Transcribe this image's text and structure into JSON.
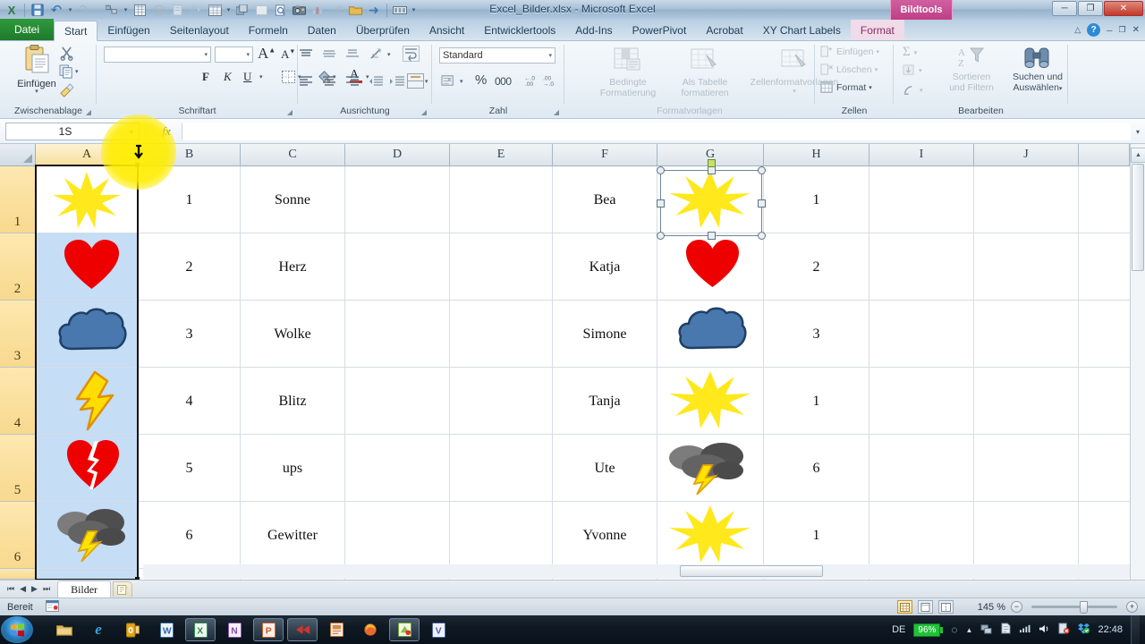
{
  "window": {
    "title": "Excel_Bilder.xlsx - Microsoft Excel",
    "minimize": "─",
    "restore": "❐",
    "close": "✕"
  },
  "quick_access": [
    {
      "name": "excel-logo-icon",
      "glyph": "X"
    },
    {
      "name": "save-icon",
      "glyph": "💾"
    },
    {
      "name": "undo-icon",
      "glyph": "↶"
    },
    {
      "name": "undo-dropdown-icon",
      "glyph": "▾"
    },
    {
      "name": "redo-icon",
      "glyph": "↷"
    },
    {
      "name": "redo-dropdown-icon",
      "glyph": "▾"
    },
    {
      "name": "shapes-icon",
      "glyph": "⌘"
    },
    {
      "name": "shapes-dropdown-icon",
      "glyph": "▾"
    },
    {
      "name": "calculate-icon",
      "glyph": "▦"
    },
    {
      "name": "spellcheck-icon",
      "glyph": "Ⓐ"
    },
    {
      "name": "format-painter-icon",
      "glyph": "▤"
    },
    {
      "name": "filter-icon",
      "glyph": "☰"
    },
    {
      "name": "table-icon",
      "glyph": "▦"
    },
    {
      "name": "table-dropdown-icon",
      "glyph": "▾"
    },
    {
      "name": "group-icon",
      "glyph": "❐"
    },
    {
      "name": "blank-icon",
      "glyph": "▭"
    },
    {
      "name": "print-preview-icon",
      "glyph": "◔"
    },
    {
      "name": "camera-icon",
      "glyph": "▣"
    },
    {
      "name": "chart-icon",
      "glyph": "▥"
    },
    {
      "name": "function-icon",
      "glyph": "ℱ"
    },
    {
      "name": "open-folder-icon",
      "glyph": "🗀"
    },
    {
      "name": "arrow-icon",
      "glyph": "➡"
    },
    {
      "name": "qat-customize-icon",
      "glyph": "▬"
    },
    {
      "name": "qat-dropdown-icon",
      "glyph": "▾"
    }
  ],
  "tabs": [
    {
      "label": "Datei",
      "state": "file"
    },
    {
      "label": "Start",
      "state": "active"
    },
    {
      "label": "Einfügen",
      "state": "normal"
    },
    {
      "label": "Seitenlayout",
      "state": "normal"
    },
    {
      "label": "Formeln",
      "state": "normal"
    },
    {
      "label": "Daten",
      "state": "normal"
    },
    {
      "label": "Überprüfen",
      "state": "normal"
    },
    {
      "label": "Ansicht",
      "state": "normal"
    },
    {
      "label": "Entwicklertools",
      "state": "normal"
    },
    {
      "label": "Add-Ins",
      "state": "normal"
    },
    {
      "label": "PowerPivot",
      "state": "normal"
    },
    {
      "label": "Acrobat",
      "state": "normal"
    },
    {
      "label": "XY Chart Labels",
      "state": "normal"
    },
    {
      "label": "Format",
      "state": "context"
    }
  ],
  "contextual_tab_group": {
    "label": "Bildtools",
    "color": "#bf3e86"
  },
  "help_icons": [
    {
      "name": "minimize-ribbon-icon",
      "glyph": "△"
    },
    {
      "name": "help-icon",
      "glyph": "?"
    },
    {
      "name": "window-minimize-icon",
      "glyph": "─"
    },
    {
      "name": "window-restore-icon",
      "glyph": "❐"
    },
    {
      "name": "window-close-icon",
      "glyph": "✕"
    }
  ],
  "ribbon": {
    "groups": [
      {
        "name": "zwischenablage",
        "label": "Zwischenablage",
        "items": [
          {
            "name": "paste-button",
            "label": "Einfügen",
            "icon": "clipboard-icon"
          },
          {
            "name": "cut-button",
            "label": "",
            "icon": "scissors-icon"
          },
          {
            "name": "copy-button",
            "label": "",
            "icon": "copy-icon"
          },
          {
            "name": "format-painter-button",
            "label": "",
            "icon": "paintbrush-icon"
          }
        ]
      },
      {
        "name": "schriftart",
        "label": "Schriftart",
        "font_name": "",
        "font_size": "",
        "items": [
          {
            "name": "grow-font-button",
            "label": "A",
            "icon": "grow-font-icon"
          },
          {
            "name": "shrink-font-button",
            "label": "A",
            "icon": "shrink-font-icon"
          },
          {
            "name": "bold-button",
            "label": "F",
            "icon": "bold-icon"
          },
          {
            "name": "italic-button",
            "label": "K",
            "icon": "italic-icon"
          },
          {
            "name": "underline-button",
            "label": "U",
            "icon": "underline-icon"
          },
          {
            "name": "borders-button",
            "label": "",
            "icon": "borders-icon"
          },
          {
            "name": "fill-color-button",
            "label": "",
            "icon": "fill-color-icon"
          },
          {
            "name": "font-color-button",
            "label": "A",
            "icon": "font-color-icon"
          }
        ]
      },
      {
        "name": "ausrichtung",
        "label": "Ausrichtung",
        "items": [
          {
            "name": "align-top-button",
            "icon": "align-top-icon"
          },
          {
            "name": "align-middle-button",
            "icon": "align-middle-icon"
          },
          {
            "name": "align-bottom-button",
            "icon": "align-bottom-icon"
          },
          {
            "name": "orientation-button",
            "icon": "orientation-icon"
          },
          {
            "name": "wrap-text-button",
            "icon": "wrap-text-icon"
          },
          {
            "name": "align-left-button",
            "icon": "align-left-icon"
          },
          {
            "name": "align-center-button",
            "icon": "align-center-icon"
          },
          {
            "name": "align-right-button",
            "icon": "align-right-icon"
          },
          {
            "name": "decrease-indent-button",
            "icon": "decrease-indent-icon"
          },
          {
            "name": "increase-indent-button",
            "icon": "increase-indent-icon"
          },
          {
            "name": "merge-cells-button",
            "icon": "merge-cells-icon"
          }
        ]
      },
      {
        "name": "zahl",
        "label": "Zahl",
        "number_format": "Standard",
        "items": [
          {
            "name": "accounting-format-button",
            "label": "",
            "icon": "currency-icon"
          },
          {
            "name": "percent-format-button",
            "label": "%",
            "icon": "percent-icon"
          },
          {
            "name": "thousands-format-button",
            "label": "000",
            "icon": "comma-icon"
          },
          {
            "name": "increase-decimal-button",
            "label": "",
            "icon": "increase-decimal-icon"
          },
          {
            "name": "decrease-decimal-button",
            "label": "",
            "icon": "decrease-decimal-icon"
          }
        ]
      },
      {
        "name": "formatvorlagen",
        "label": "Formatvorlagen",
        "items": [
          {
            "name": "conditional-formatting-button",
            "label": "Bedingte\nFormatierung",
            "line1": "Bedingte",
            "line2": "Formatierung",
            "icon": "conditional-format-icon"
          },
          {
            "name": "format-as-table-button",
            "line1": "Als Tabelle",
            "line2": "formatieren",
            "icon": "table-style-icon"
          },
          {
            "name": "cell-styles-button",
            "line1": "Zellenformatvorlagen",
            "line2": "",
            "icon": "cell-style-icon"
          }
        ]
      },
      {
        "name": "zellen",
        "label": "Zellen",
        "items": [
          {
            "name": "insert-cells-button",
            "label": "Einfügen",
            "icon": "insert-cells-icon"
          },
          {
            "name": "delete-cells-button",
            "label": "Löschen",
            "icon": "delete-cells-icon"
          },
          {
            "name": "format-cells-button",
            "label": "Format",
            "icon": "format-cells-icon"
          }
        ]
      },
      {
        "name": "bearbeiten",
        "label": "Bearbeiten",
        "items": [
          {
            "name": "autosum-button",
            "label": "Σ",
            "icon": "autosum-icon"
          },
          {
            "name": "fill-button",
            "label": "",
            "icon": "fill-down-icon"
          },
          {
            "name": "clear-button",
            "label": "",
            "icon": "eraser-icon"
          },
          {
            "name": "sort-filter-button",
            "line1": "Sortieren",
            "line2": "und Filtern",
            "icon": "sort-filter-icon"
          },
          {
            "name": "find-select-button",
            "line1": "Suchen und",
            "line2": "Auswählen",
            "icon": "binoculars-icon"
          }
        ]
      }
    ]
  },
  "formula_bar": {
    "name_box_value": "1S",
    "name_box_dropdown": "▾",
    "fx_label": "fx",
    "formula_value": "",
    "expand_icon": "▾",
    "cancel_icon": "✕",
    "accept_icon": "✓"
  },
  "grid": {
    "columns": [
      {
        "label": "A",
        "selected": true
      },
      {
        "label": "B",
        "selected": false
      },
      {
        "label": "C",
        "selected": false
      },
      {
        "label": "D",
        "selected": false
      },
      {
        "label": "E",
        "selected": false
      },
      {
        "label": "F",
        "selected": false
      },
      {
        "label": "G",
        "selected": false
      },
      {
        "label": "H",
        "selected": false
      },
      {
        "label": "I",
        "selected": false
      },
      {
        "label": "J",
        "selected": false
      }
    ],
    "rows": [
      {
        "label": "1",
        "image_a": "sun-icon",
        "b": "1",
        "c": "Sonne",
        "d": "",
        "e": "",
        "f": "Bea",
        "image_g": "sun-icon",
        "h": "1"
      },
      {
        "label": "2",
        "image_a": "heart-icon",
        "b": "2",
        "c": "Herz",
        "d": "",
        "e": "",
        "f": "Katja",
        "image_g": "heart-icon",
        "h": "2"
      },
      {
        "label": "3",
        "image_a": "cloud-icon",
        "b": "3",
        "c": "Wolke",
        "d": "",
        "e": "",
        "f": "Simone",
        "image_g": "cloud-icon",
        "h": "3"
      },
      {
        "label": "4",
        "image_a": "lightning-icon",
        "b": "4",
        "c": "Blitz",
        "d": "",
        "e": "",
        "f": "Tanja",
        "image_g": "sun-icon",
        "h": "1"
      },
      {
        "label": "5",
        "image_a": "broken-heart-icon",
        "b": "5",
        "c": "ups",
        "d": "",
        "e": "",
        "f": "Ute",
        "image_g": "thunderstorm-icon",
        "h": "6"
      },
      {
        "label": "6",
        "image_a": "thunderstorm-icon",
        "b": "6",
        "c": "Gewitter",
        "d": "",
        "e": "",
        "f": "Yvonne",
        "image_g": "sun-icon",
        "h": "1"
      }
    ],
    "column_a_fill_color": "#c5ddf5",
    "selected_cell": "A1",
    "selected_picture_cell": "G1"
  },
  "sheet_tabs": {
    "nav": [
      {
        "name": "first-sheet-button",
        "glyph": "⏮"
      },
      {
        "name": "prev-sheet-button",
        "glyph": "◀"
      },
      {
        "name": "next-sheet-button",
        "glyph": "▶"
      },
      {
        "name": "last-sheet-button",
        "glyph": "⏭"
      }
    ],
    "tabs": [
      {
        "label": "Bilder",
        "active": true
      }
    ],
    "add_sheet_glyph": "⬚"
  },
  "status_bar": {
    "mode": "Bereit",
    "macro_icon": "record-macro-icon",
    "views": [
      {
        "name": "normal-view-button",
        "glyph": "▦",
        "active": true
      },
      {
        "name": "page-layout-view-button",
        "glyph": "▤",
        "active": false
      },
      {
        "name": "page-break-view-button",
        "glyph": "▥",
        "active": false
      }
    ],
    "zoom": "145 %",
    "zoom_out_glyph": "−",
    "zoom_in_glyph": "+"
  },
  "taskbar": {
    "start_glyph": "⊞",
    "apps": [
      {
        "name": "explorer-taskbar-icon",
        "glyph": "🗀",
        "color": "#e8c46a",
        "active": false
      },
      {
        "name": "internet-explorer-taskbar-icon",
        "glyph": "e",
        "color": "#2f9fe0",
        "active": false
      },
      {
        "name": "outlook-taskbar-icon",
        "glyph": "O",
        "color": "#e8a317",
        "active": false
      },
      {
        "name": "word-taskbar-icon",
        "glyph": "W",
        "color": "#3b7ed0",
        "active": false
      },
      {
        "name": "excel-taskbar-icon",
        "glyph": "X",
        "color": "#3fa45c",
        "active": true
      },
      {
        "name": "onenote-taskbar-icon",
        "glyph": "N",
        "color": "#a564b8",
        "active": false
      },
      {
        "name": "powerpoint-taskbar-icon",
        "glyph": "P",
        "color": "#e06a3a",
        "active": true
      },
      {
        "name": "media-taskbar-icon",
        "glyph": "◀",
        "color": "#d53a3a",
        "active": true
      },
      {
        "name": "publisher-taskbar-icon",
        "glyph": "▣",
        "color": "#d4762a",
        "active": false
      },
      {
        "name": "firefox-taskbar-icon",
        "glyph": "✿",
        "color": "#e06a20",
        "active": false
      },
      {
        "name": "snagit-taskbar-icon",
        "glyph": "◩",
        "color": "#9acd32",
        "active": true
      },
      {
        "name": "visio-taskbar-icon",
        "glyph": "V",
        "color": "#6f8fd0",
        "active": false
      }
    ],
    "tray": {
      "language": "DE",
      "battery_percent": "96%",
      "clock": "22:48",
      "icons": [
        {
          "name": "show-hidden-icons",
          "glyph": "▲"
        },
        {
          "name": "network-icon",
          "glyph": "☲"
        },
        {
          "name": "action-center-icon",
          "glyph": "⚑"
        },
        {
          "name": "signal-icon",
          "glyph": "▄"
        },
        {
          "name": "volume-icon",
          "glyph": "🔊"
        },
        {
          "name": "antivirus-icon",
          "glyph": "◧"
        },
        {
          "name": "dropbox-icon",
          "glyph": "❖"
        }
      ]
    }
  },
  "cursor": {
    "type": "column-resize-cursor",
    "highlight_color": "#ffee00"
  }
}
